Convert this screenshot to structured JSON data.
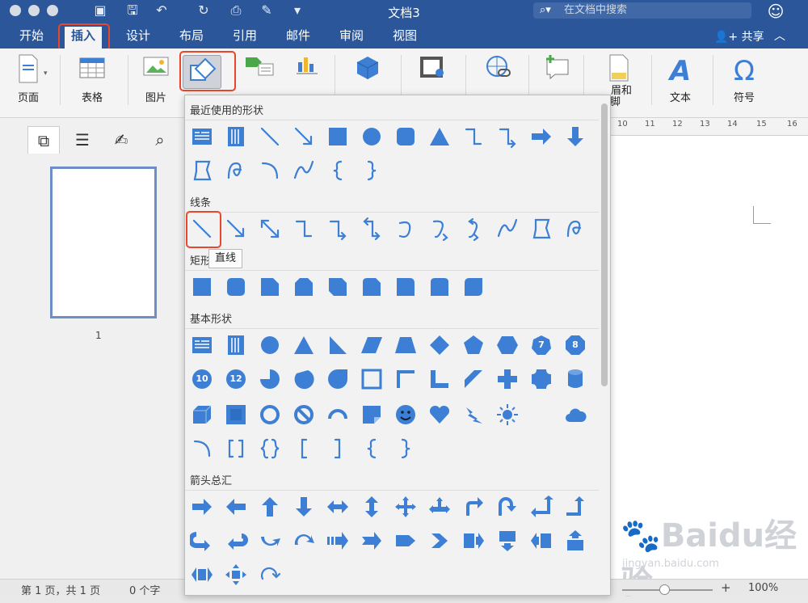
{
  "window": {
    "title": "文档3",
    "search_placeholder": "在文档中搜索",
    "share_label": "共享"
  },
  "tabs": [
    "开始",
    "插入",
    "设计",
    "布局",
    "引用",
    "邮件",
    "审阅",
    "视图"
  ],
  "ribbon": {
    "page_label": "页面",
    "table_label": "表格",
    "picture_label": "图片",
    "header_footer_label_1": "眉和",
    "header_footer_label_2": "页脚",
    "text_label": "文本",
    "symbol_label": "符号"
  },
  "nav": {
    "page_number": "1"
  },
  "ruler": [
    "10",
    "11",
    "12",
    "13",
    "14",
    "15",
    "16"
  ],
  "gallery": {
    "categories": [
      "最近使用的形状",
      "线条",
      "矩形",
      "基本形状",
      "箭头总汇"
    ],
    "tooltip": "直线",
    "basic_badges": [
      "7",
      "8",
      "10",
      "12"
    ]
  },
  "status": {
    "page": "第 1 页，共 1 页",
    "words": "0 个字",
    "zoom": "100%",
    "zoom_plus": "+"
  },
  "watermark": {
    "brand": "Baidu经验",
    "url": "jingyan.baidu.com"
  },
  "colors": {
    "titlebar": "#2b579a",
    "shape_fill": "#3c7fd4",
    "highlight": "#e8472b"
  }
}
